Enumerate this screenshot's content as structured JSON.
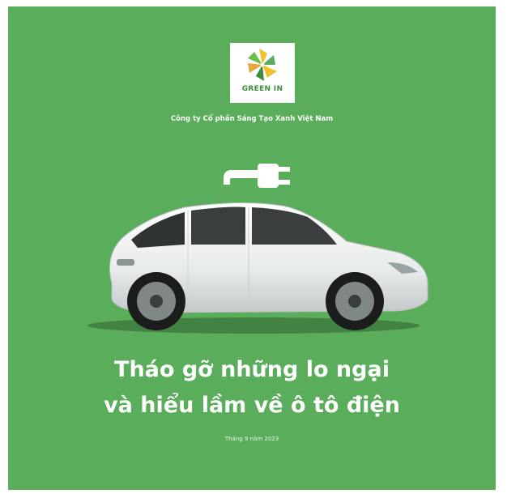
{
  "brand": {
    "logo_text": "GREEN IN",
    "company_name": "Công ty Cổ phần Sáng Tạo Xanh Việt Nam"
  },
  "headline": {
    "line1": "Tháo gỡ những lo ngại",
    "line2": "và hiểu lầm về ô tô điện"
  },
  "date": "Tháng 9 năm 2023",
  "colors": {
    "background": "#5aad5a",
    "text": "#ffffff",
    "logo_green": "#3d8a3d",
    "logo_yellow": "#f2c12e"
  },
  "icons": [
    "plug-icon",
    "electric-car-image",
    "pinwheel-logo"
  ]
}
